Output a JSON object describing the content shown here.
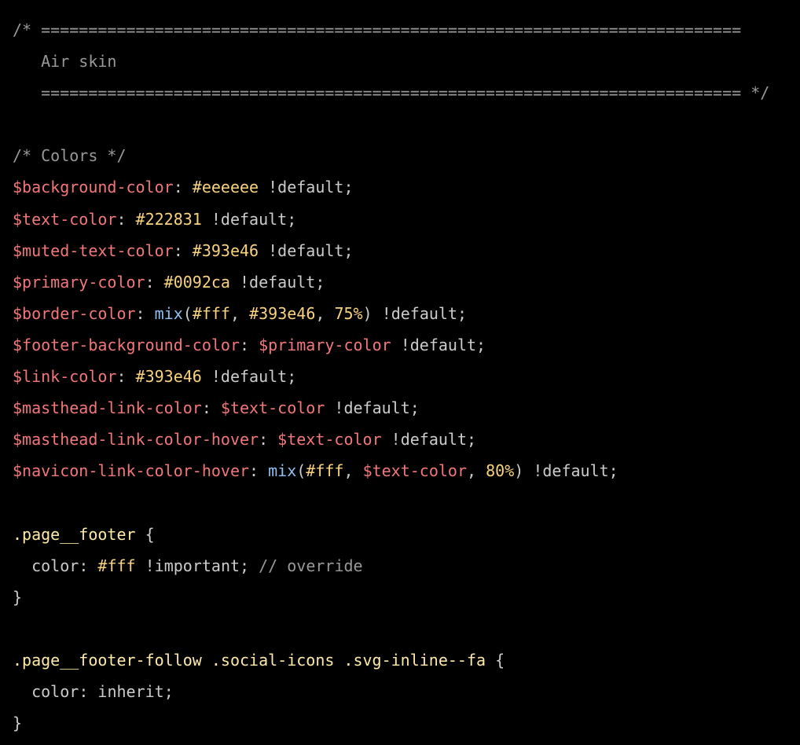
{
  "editor": {
    "language": "scss",
    "colors": {
      "background": "#000000",
      "comment": "#999999",
      "variable": "#f2777a",
      "number": "#f9d37d",
      "function": "#8fc1f3",
      "selector": "#ffe9a8",
      "plain": "#cccccc"
    },
    "lines": [
      [
        {
          "t": "comment",
          "v": "/* =========================================================================="
        }
      ],
      [
        {
          "t": "comment",
          "v": "   Air skin"
        }
      ],
      [
        {
          "t": "comment",
          "v": "   ========================================================================== */"
        }
      ],
      [],
      [
        {
          "t": "comment",
          "v": "/* Colors */"
        }
      ],
      [
        {
          "t": "variable",
          "v": "$background-color"
        },
        {
          "t": "punct",
          "v": ": "
        },
        {
          "t": "number",
          "v": "#eeeeee"
        },
        {
          "t": "punct",
          "v": " "
        },
        {
          "t": "bang",
          "v": "!default"
        },
        {
          "t": "punct",
          "v": ";"
        }
      ],
      [
        {
          "t": "variable",
          "v": "$text-color"
        },
        {
          "t": "punct",
          "v": ": "
        },
        {
          "t": "number",
          "v": "#222831"
        },
        {
          "t": "punct",
          "v": " "
        },
        {
          "t": "bang",
          "v": "!default"
        },
        {
          "t": "punct",
          "v": ";"
        }
      ],
      [
        {
          "t": "variable",
          "v": "$muted-text-color"
        },
        {
          "t": "punct",
          "v": ": "
        },
        {
          "t": "number",
          "v": "#393e46"
        },
        {
          "t": "punct",
          "v": " "
        },
        {
          "t": "bang",
          "v": "!default"
        },
        {
          "t": "punct",
          "v": ";"
        }
      ],
      [
        {
          "t": "variable",
          "v": "$primary-color"
        },
        {
          "t": "punct",
          "v": ": "
        },
        {
          "t": "number",
          "v": "#0092ca"
        },
        {
          "t": "punct",
          "v": " "
        },
        {
          "t": "bang",
          "v": "!default"
        },
        {
          "t": "punct",
          "v": ";"
        }
      ],
      [
        {
          "t": "variable",
          "v": "$border-color"
        },
        {
          "t": "punct",
          "v": ": "
        },
        {
          "t": "function",
          "v": "mix"
        },
        {
          "t": "punct",
          "v": "("
        },
        {
          "t": "number",
          "v": "#fff"
        },
        {
          "t": "punct",
          "v": ", "
        },
        {
          "t": "number",
          "v": "#393e46"
        },
        {
          "t": "punct",
          "v": ", "
        },
        {
          "t": "number",
          "v": "75%"
        },
        {
          "t": "punct",
          "v": ") "
        },
        {
          "t": "bang",
          "v": "!default"
        },
        {
          "t": "punct",
          "v": ";"
        }
      ],
      [
        {
          "t": "variable",
          "v": "$footer-background-color"
        },
        {
          "t": "punct",
          "v": ": "
        },
        {
          "t": "variable",
          "v": "$primary-color"
        },
        {
          "t": "punct",
          "v": " "
        },
        {
          "t": "bang",
          "v": "!default"
        },
        {
          "t": "punct",
          "v": ";"
        }
      ],
      [
        {
          "t": "variable",
          "v": "$link-color"
        },
        {
          "t": "punct",
          "v": ": "
        },
        {
          "t": "number",
          "v": "#393e46"
        },
        {
          "t": "punct",
          "v": " "
        },
        {
          "t": "bang",
          "v": "!default"
        },
        {
          "t": "punct",
          "v": ";"
        }
      ],
      [
        {
          "t": "variable",
          "v": "$masthead-link-color"
        },
        {
          "t": "punct",
          "v": ": "
        },
        {
          "t": "variable",
          "v": "$text-color"
        },
        {
          "t": "punct",
          "v": " "
        },
        {
          "t": "bang",
          "v": "!default"
        },
        {
          "t": "punct",
          "v": ";"
        }
      ],
      [
        {
          "t": "variable",
          "v": "$masthead-link-color-hover"
        },
        {
          "t": "punct",
          "v": ": "
        },
        {
          "t": "variable",
          "v": "$text-color"
        },
        {
          "t": "punct",
          "v": " "
        },
        {
          "t": "bang",
          "v": "!default"
        },
        {
          "t": "punct",
          "v": ";"
        }
      ],
      [
        {
          "t": "variable",
          "v": "$navicon-link-color-hover"
        },
        {
          "t": "punct",
          "v": ": "
        },
        {
          "t": "function",
          "v": "mix"
        },
        {
          "t": "punct",
          "v": "("
        },
        {
          "t": "number",
          "v": "#fff"
        },
        {
          "t": "punct",
          "v": ", "
        },
        {
          "t": "variable",
          "v": "$text-color"
        },
        {
          "t": "punct",
          "v": ", "
        },
        {
          "t": "number",
          "v": "80%"
        },
        {
          "t": "punct",
          "v": ") "
        },
        {
          "t": "bang",
          "v": "!default"
        },
        {
          "t": "punct",
          "v": ";"
        }
      ],
      [],
      [
        {
          "t": "selector",
          "v": ".page__footer"
        },
        {
          "t": "punct",
          "v": " {"
        }
      ],
      [
        {
          "t": "punct",
          "v": "  "
        },
        {
          "t": "keyword",
          "v": "color"
        },
        {
          "t": "punct",
          "v": ": "
        },
        {
          "t": "number",
          "v": "#fff"
        },
        {
          "t": "punct",
          "v": " "
        },
        {
          "t": "bang",
          "v": "!important"
        },
        {
          "t": "punct",
          "v": "; "
        },
        {
          "t": "comment",
          "v": "// override"
        }
      ],
      [
        {
          "t": "punct",
          "v": "}"
        }
      ],
      [],
      [
        {
          "t": "selector",
          "v": ".page__footer-follow .social-icons .svg-inline--fa"
        },
        {
          "t": "punct",
          "v": " {"
        }
      ],
      [
        {
          "t": "punct",
          "v": "  "
        },
        {
          "t": "keyword",
          "v": "color"
        },
        {
          "t": "punct",
          "v": ": "
        },
        {
          "t": "keyword",
          "v": "inherit"
        },
        {
          "t": "punct",
          "v": ";"
        }
      ],
      [
        {
          "t": "punct",
          "v": "}"
        }
      ]
    ]
  }
}
